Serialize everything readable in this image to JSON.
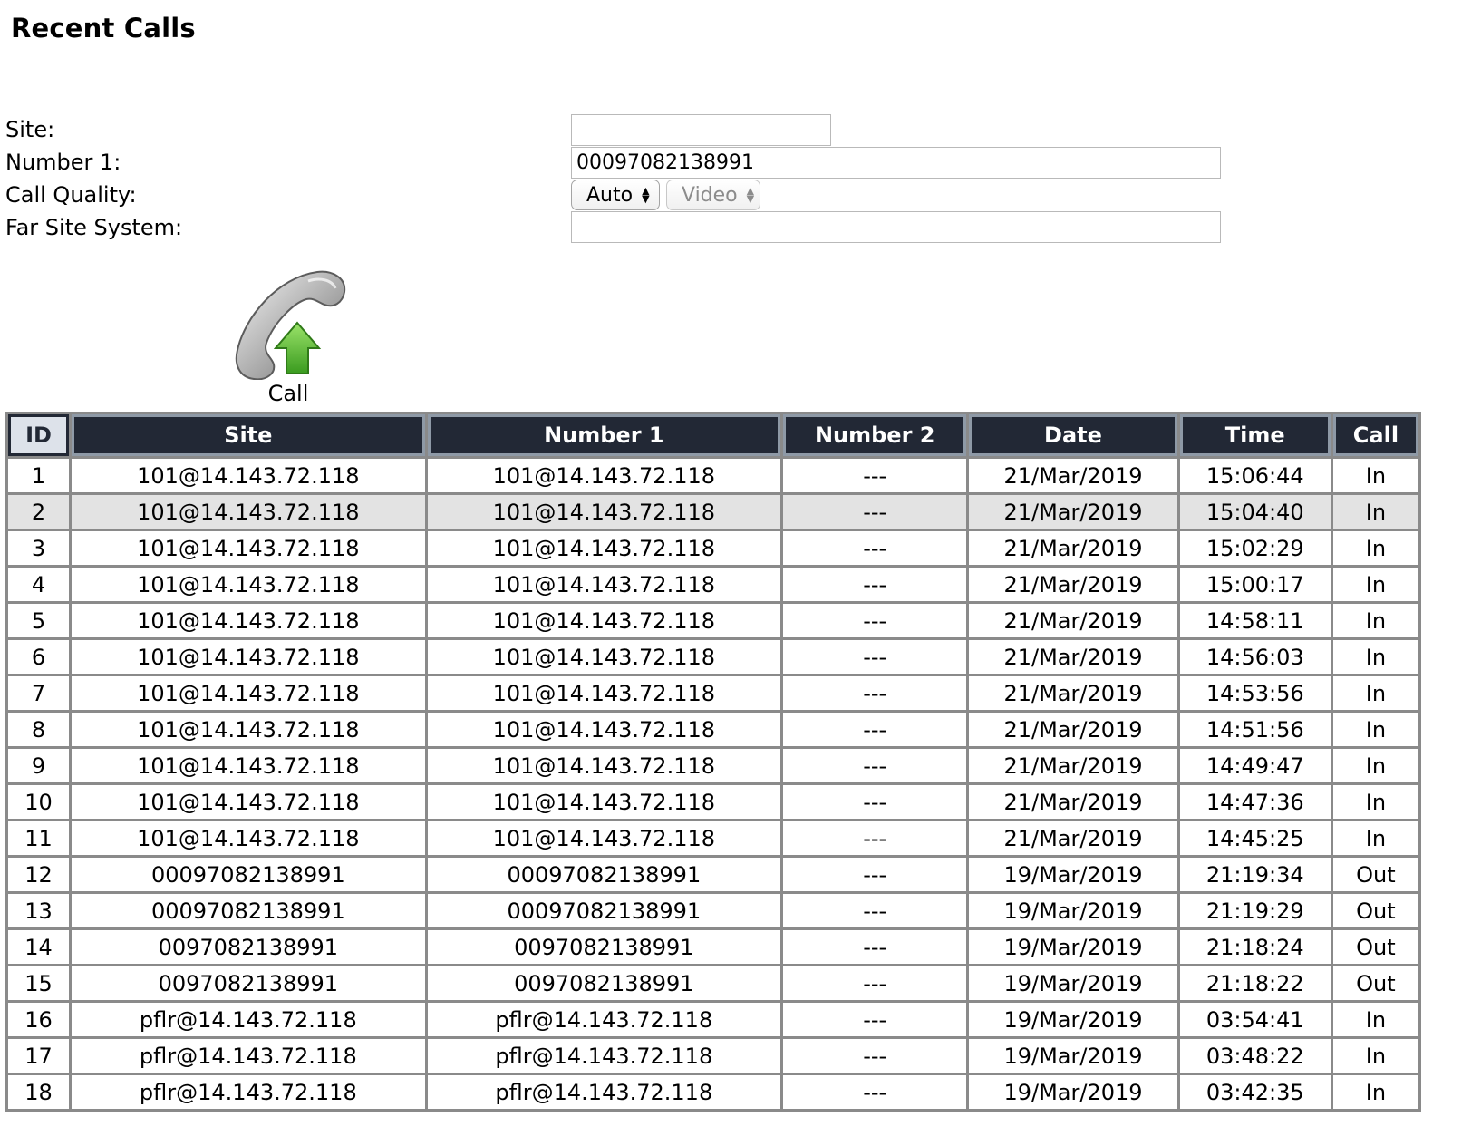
{
  "page": {
    "title": "Recent Calls"
  },
  "form": {
    "site_label": "Site:",
    "site_value": "",
    "number1_label": "Number 1:",
    "number1_value": "00097082138991",
    "call_quality_label": "Call Quality:",
    "call_quality_value": "Auto",
    "call_type_value": "Video",
    "far_site_label": "Far Site System:",
    "far_site_value": ""
  },
  "call_button": {
    "label": "Call",
    "icon": "phone-call-icon"
  },
  "table": {
    "columns": [
      "ID",
      "Site",
      "Number 1",
      "Number 2",
      "Date",
      "Time",
      "Call"
    ],
    "rows": [
      {
        "id": "1",
        "site": "101@14.143.72.118",
        "number1": "101@14.143.72.118",
        "number2": "---",
        "date": "21/Mar/2019",
        "time": "15:06:44",
        "call": "In"
      },
      {
        "id": "2",
        "site": "101@14.143.72.118",
        "number1": "101@14.143.72.118",
        "number2": "---",
        "date": "21/Mar/2019",
        "time": "15:04:40",
        "call": "In"
      },
      {
        "id": "3",
        "site": "101@14.143.72.118",
        "number1": "101@14.143.72.118",
        "number2": "---",
        "date": "21/Mar/2019",
        "time": "15:02:29",
        "call": "In"
      },
      {
        "id": "4",
        "site": "101@14.143.72.118",
        "number1": "101@14.143.72.118",
        "number2": "---",
        "date": "21/Mar/2019",
        "time": "15:00:17",
        "call": "In"
      },
      {
        "id": "5",
        "site": "101@14.143.72.118",
        "number1": "101@14.143.72.118",
        "number2": "---",
        "date": "21/Mar/2019",
        "time": "14:58:11",
        "call": "In"
      },
      {
        "id": "6",
        "site": "101@14.143.72.118",
        "number1": "101@14.143.72.118",
        "number2": "---",
        "date": "21/Mar/2019",
        "time": "14:56:03",
        "call": "In"
      },
      {
        "id": "7",
        "site": "101@14.143.72.118",
        "number1": "101@14.143.72.118",
        "number2": "---",
        "date": "21/Mar/2019",
        "time": "14:53:56",
        "call": "In"
      },
      {
        "id": "8",
        "site": "101@14.143.72.118",
        "number1": "101@14.143.72.118",
        "number2": "---",
        "date": "21/Mar/2019",
        "time": "14:51:56",
        "call": "In"
      },
      {
        "id": "9",
        "site": "101@14.143.72.118",
        "number1": "101@14.143.72.118",
        "number2": "---",
        "date": "21/Mar/2019",
        "time": "14:49:47",
        "call": "In"
      },
      {
        "id": "10",
        "site": "101@14.143.72.118",
        "number1": "101@14.143.72.118",
        "number2": "---",
        "date": "21/Mar/2019",
        "time": "14:47:36",
        "call": "In"
      },
      {
        "id": "11",
        "site": "101@14.143.72.118",
        "number1": "101@14.143.72.118",
        "number2": "---",
        "date": "21/Mar/2019",
        "time": "14:45:25",
        "call": "In"
      },
      {
        "id": "12",
        "site": "00097082138991",
        "number1": "00097082138991",
        "number2": "---",
        "date": "19/Mar/2019",
        "time": "21:19:34",
        "call": "Out"
      },
      {
        "id": "13",
        "site": "00097082138991",
        "number1": "00097082138991",
        "number2": "---",
        "date": "19/Mar/2019",
        "time": "21:19:29",
        "call": "Out"
      },
      {
        "id": "14",
        "site": "0097082138991",
        "number1": "0097082138991",
        "number2": "---",
        "date": "19/Mar/2019",
        "time": "21:18:24",
        "call": "Out"
      },
      {
        "id": "15",
        "site": "0097082138991",
        "number1": "0097082138991",
        "number2": "---",
        "date": "19/Mar/2019",
        "time": "21:18:22",
        "call": "Out"
      },
      {
        "id": "16",
        "site": "pflr@14.143.72.118",
        "number1": "pflr@14.143.72.118",
        "number2": "---",
        "date": "19/Mar/2019",
        "time": "03:54:41",
        "call": "In"
      },
      {
        "id": "17",
        "site": "pflr@14.143.72.118",
        "number1": "pflr@14.143.72.118",
        "number2": "---",
        "date": "19/Mar/2019",
        "time": "03:48:22",
        "call": "In"
      },
      {
        "id": "18",
        "site": "pflr@14.143.72.118",
        "number1": "pflr@14.143.72.118",
        "number2": "---",
        "date": "19/Mar/2019",
        "time": "03:42:35",
        "call": "In"
      }
    ],
    "highlighted_row": "2"
  },
  "colors": {
    "header_bg": "#222835",
    "header_text": "#ffffff",
    "sorted_header_bg": "#dde2ea",
    "grid": "#8a8a8a",
    "row_highlight": "#e3e3e3",
    "call_arrow": "#4caf2a"
  }
}
